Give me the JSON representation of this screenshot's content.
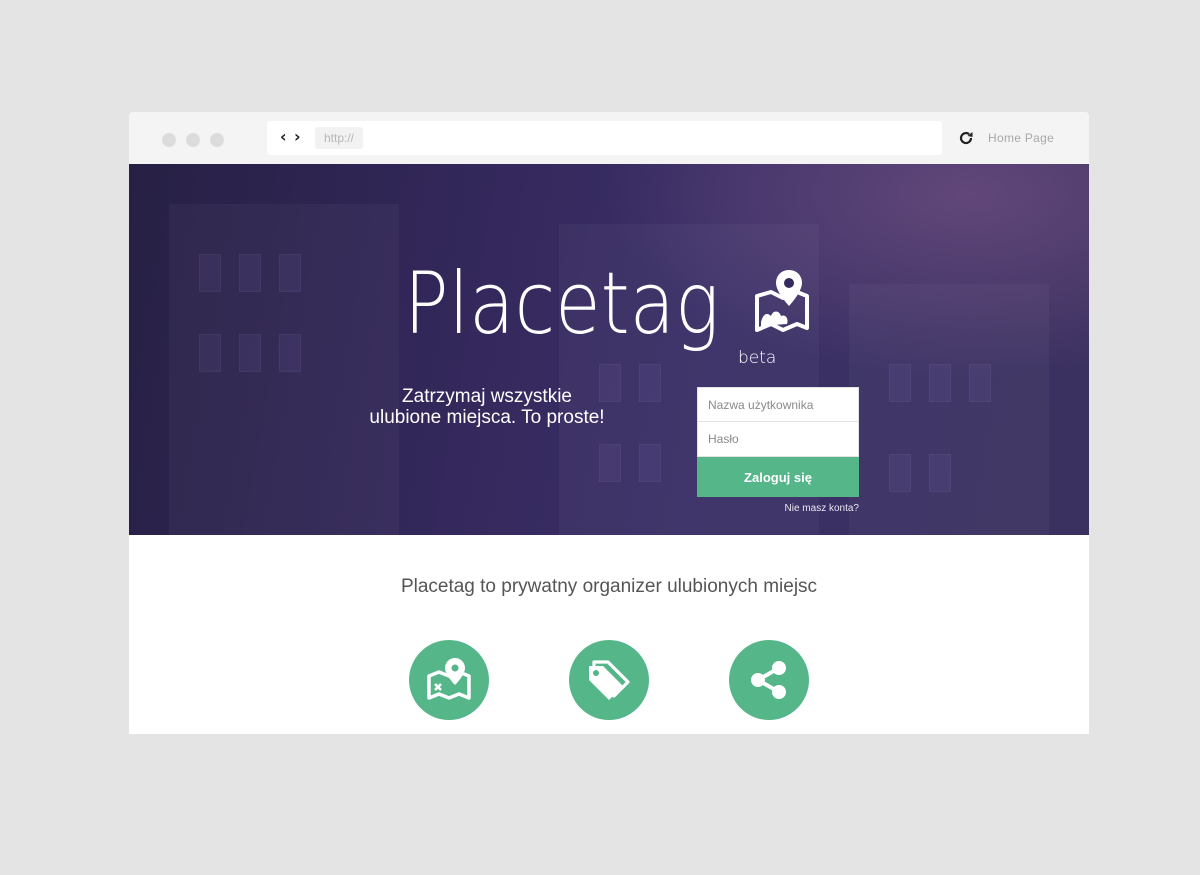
{
  "browser": {
    "url": "http://",
    "home_link": "Home Page",
    "icons": [
      "back-arrow-icon",
      "forward-arrow-icon",
      "reload-icon"
    ]
  },
  "hero": {
    "logo": "Placetag",
    "beta": "beta",
    "tagline_line1": "Zatrzymaj wszystkie",
    "tagline_line2": "ulubione miejsca. To proste!",
    "login": {
      "username_placeholder": "Nazwa użytkownika",
      "password_placeholder": "Hasło",
      "submit_label": "Zaloguj się",
      "signup_link": "Nie masz konta?"
    }
  },
  "content": {
    "subtitle": "Placetag to prywatny organizer ulubionych miejsc",
    "features": [
      {
        "icon": "map-pin-icon"
      },
      {
        "icon": "tag-icon"
      },
      {
        "icon": "share-icon"
      }
    ]
  },
  "colors": {
    "accent": "#55b68a",
    "hero_background": "#35295e",
    "page_background": "#e4e4e4"
  }
}
